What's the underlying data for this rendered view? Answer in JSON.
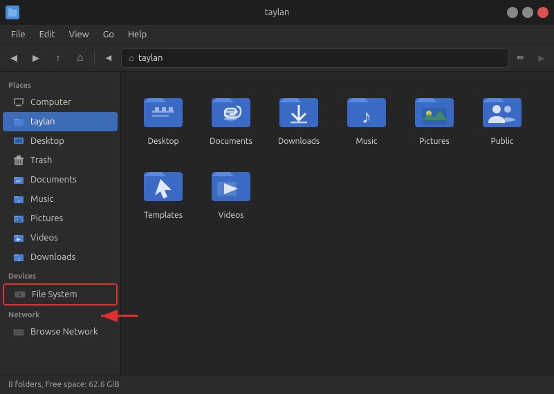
{
  "titlebar": {
    "title": "taylan",
    "app_icon": "folder",
    "btn_minimize": "–",
    "btn_maximize": "□",
    "btn_close": "✕"
  },
  "menubar": {
    "items": [
      "File",
      "Edit",
      "View",
      "Go",
      "Help"
    ]
  },
  "toolbar": {
    "back_label": "◀",
    "forward_label": "▶",
    "up_label": "↑",
    "home_label": "⌂",
    "breadcrumb_separator": "▶",
    "breadcrumb_path": "taylan",
    "edit_label": "✏",
    "nav_label": "▶"
  },
  "sidebar": {
    "sections": [
      {
        "label": "Places",
        "items": [
          {
            "id": "computer",
            "label": "Computer",
            "icon": "computer"
          },
          {
            "id": "taylan",
            "label": "taylan",
            "icon": "home",
            "active": true
          },
          {
            "id": "desktop",
            "label": "Desktop",
            "icon": "desktop"
          },
          {
            "id": "trash",
            "label": "Trash",
            "icon": "trash"
          },
          {
            "id": "documents",
            "label": "Documents",
            "icon": "documents"
          },
          {
            "id": "music",
            "label": "Music",
            "icon": "music"
          },
          {
            "id": "pictures",
            "label": "Pictures",
            "icon": "pictures"
          },
          {
            "id": "videos",
            "label": "Videos",
            "icon": "videos"
          },
          {
            "id": "downloads",
            "label": "Downloads",
            "icon": "downloads"
          }
        ]
      },
      {
        "label": "Devices",
        "items": [
          {
            "id": "filesystem",
            "label": "File System",
            "icon": "harddisk",
            "highlighted": true
          }
        ]
      },
      {
        "label": "Network",
        "items": [
          {
            "id": "network",
            "label": "Browse Network",
            "icon": "network"
          }
        ]
      }
    ]
  },
  "files": [
    {
      "id": "desktop",
      "label": "Desktop",
      "icon": "folder-blue"
    },
    {
      "id": "documents",
      "label": "Documents",
      "icon": "folder-documents"
    },
    {
      "id": "downloads",
      "label": "Downloads",
      "icon": "folder-downloads"
    },
    {
      "id": "music",
      "label": "Music",
      "icon": "folder-music"
    },
    {
      "id": "pictures",
      "label": "Pictures",
      "icon": "folder-pictures"
    },
    {
      "id": "public",
      "label": "Public",
      "icon": "folder-public"
    },
    {
      "id": "templates",
      "label": "Templates",
      "icon": "folder-templates"
    },
    {
      "id": "videos",
      "label": "Videos",
      "icon": "folder-videos"
    }
  ],
  "statusbar": {
    "text": "8 folders, Free space: 62.6 GiB"
  },
  "colors": {
    "folder_blue": "#4a7fd4",
    "folder_dark": "#3a6ac4",
    "active_sidebar": "#3d6bb5",
    "highlight_red": "#e03030"
  }
}
